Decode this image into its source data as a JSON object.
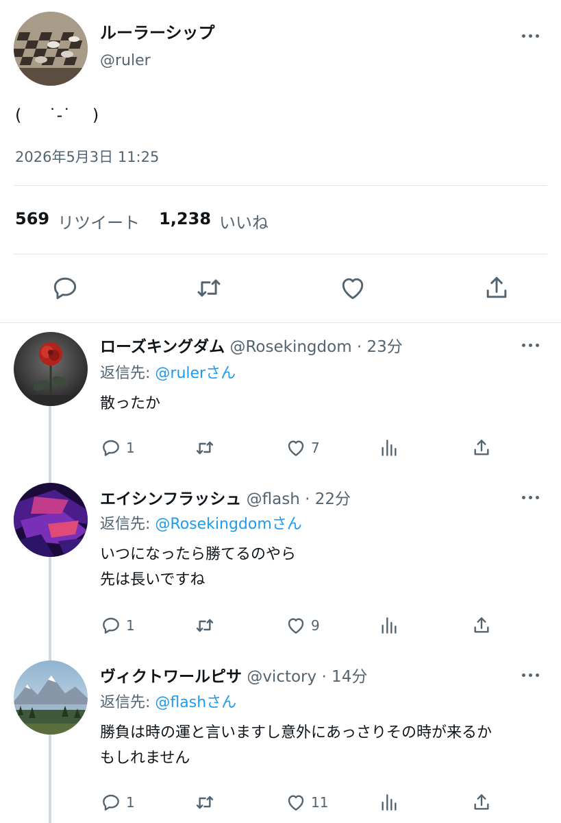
{
  "main_tweet": {
    "display_name": "ルーラーシップ",
    "handle": "@ruler",
    "text": "(　  ˙-˙ 　)",
    "timestamp": "2026年5月3日 11:25",
    "retweets_count": "569",
    "retweets_label": "リツイート",
    "likes_count": "1,238",
    "likes_label": "いいね",
    "icons": [
      "reply-icon",
      "retweet-icon",
      "like-icon",
      "share-icon",
      "more-icon"
    ]
  },
  "replies": [
    {
      "display_name": "ローズキングダム",
      "handle": "@Rosekingdom",
      "time": "· 23分",
      "reply_prefix": "返信先: ",
      "reply_to": "@rulerさん",
      "text": "散ったか",
      "reply_count": "1",
      "like_count": "7"
    },
    {
      "display_name": "エイシンフラッシュ",
      "handle": "@flash",
      "time": "· 22分",
      "reply_prefix": "返信先: ",
      "reply_to": "@Rosekingdomさん",
      "text": "いつになったら勝てるのやら\n先は長いですね",
      "reply_count": "1",
      "like_count": "9"
    },
    {
      "display_name": "ヴィクトワールピサ",
      "handle": "@victory",
      "time": "· 14分",
      "reply_prefix": "返信先: ",
      "reply_to": "@flashさん",
      "text": "勝負は時の運と言いますし意外にあっさりその時が来るか\nもしれません",
      "reply_count": "1",
      "like_count": "11"
    }
  ],
  "colors": {
    "text": "#0f1419",
    "muted": "#536471",
    "link": "#1d9bf0",
    "divider": "#e1e6ea",
    "thread_line": "#cfd9de"
  }
}
